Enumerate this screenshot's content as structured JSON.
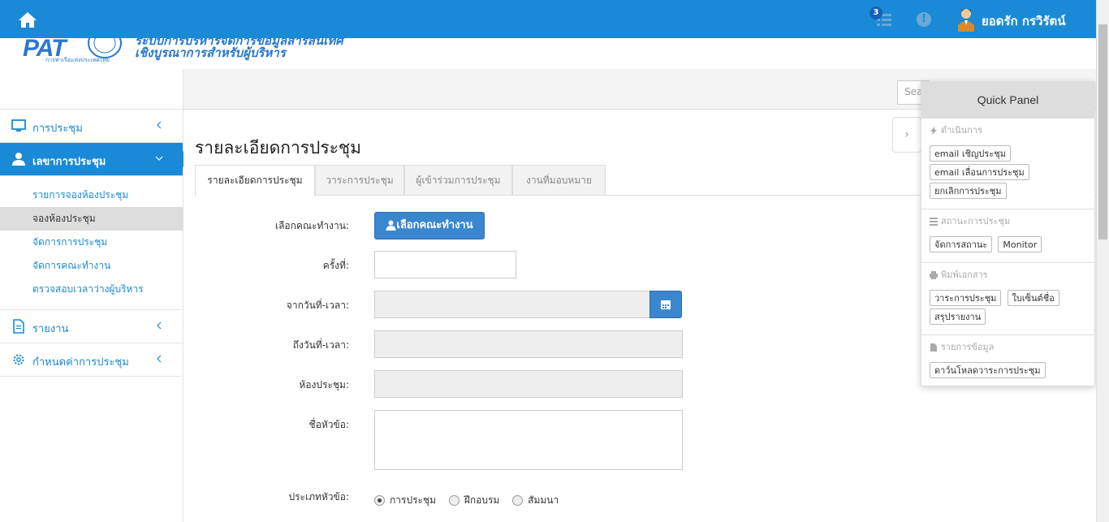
{
  "header": {
    "notification_count": "3",
    "user_name": "ยอดรัก กรวิรัตน์"
  },
  "logo": {
    "brand": "PAT",
    "brand_sub": "การท่าเรือแห่งประเทศไทย",
    "line1": "ระบบการบริหารจัดการข้อมูลสารสนเทศ",
    "line2": "เชิงบูรณาการสำหรับผู้บริหาร"
  },
  "sidebar": {
    "items": [
      {
        "label": "การประชุม",
        "icon": "monitor-icon"
      },
      {
        "label": "เลขาการประชุม",
        "icon": "user-icon"
      },
      {
        "label": "รายงาน",
        "icon": "document-icon"
      },
      {
        "label": "กำหนดค่าการประชุม",
        "icon": "gear-icon"
      }
    ],
    "subitems": [
      "รายการจองห้องประชุม",
      "จองห้องประชุม",
      "จัดการการประชุม",
      "จัดการคณะทำงาน",
      "ตรวจสอบเวลาว่างผู้บริหาร"
    ]
  },
  "search": {
    "placeholder": "Search"
  },
  "main": {
    "title": "รายละเอียดการประชุม",
    "tabs": [
      "รายละเอียดการประชุม",
      "วาระการประชุม",
      "ผู้เข้าร่วมการประชุม",
      "งานที่มอบหมาย"
    ],
    "form": {
      "committee_label": "เลือกคณะทำงาน:",
      "committee_button": "เลือกคณะทำงาน",
      "number_label": "ครั้งที่:",
      "from_label": "จากวันที่-เวลา:",
      "to_label": "ถึงวันที่-เวลา:",
      "room_label": "ห้องประชุม:",
      "subject_label": "ชื่อหัวข้อ:",
      "type_label": "ประเภทหัวข้อ:",
      "type_options": [
        "การประชุม",
        "ฝึกอบรม",
        "สัมมนา"
      ],
      "type_selected": "การประชุม"
    }
  },
  "quick_panel": {
    "title": "Quick Panel",
    "sections": [
      {
        "title": "ดำเนินการ",
        "icon": "bolt-icon",
        "buttons": [
          "email เชิญประชุม",
          "email เลื่อนการประชุม",
          "ยกเลิกการประชุม"
        ]
      },
      {
        "title": "สถานะการประชุม",
        "icon": "list-icon",
        "buttons": [
          "จัดการสถานะ",
          "Monitor"
        ]
      },
      {
        "title": "พิมพ์เอกสาร",
        "icon": "print-icon",
        "buttons": [
          "วาระการประชุม",
          "ใบเซ็นต์ชื่อ",
          "สรุปรายงาน"
        ]
      },
      {
        "title": "รายการข้อมูล",
        "icon": "file-icon",
        "buttons": [
          "ดาว์นโหลดวาระการประชุม"
        ]
      }
    ]
  },
  "colors": {
    "primary": "#1a8ad6",
    "button": "#3a87cf",
    "readonly": "#eeeeee"
  }
}
